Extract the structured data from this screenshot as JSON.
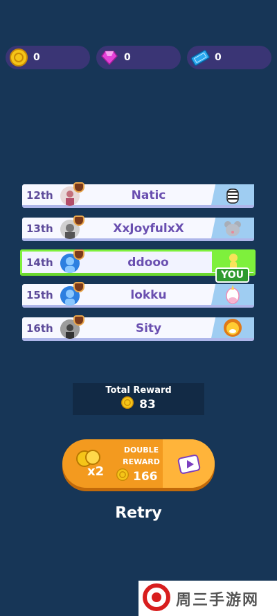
{
  "currencies": [
    {
      "name": "coin-icon",
      "value": "0",
      "color": "#f5c518"
    },
    {
      "name": "gem-icon",
      "value": "0",
      "color": "#e541d8"
    },
    {
      "name": "ticket-icon",
      "value": "0",
      "color": "#2aa8ef"
    }
  ],
  "leaderboard": [
    {
      "rank": "12th",
      "name": "Natic",
      "pet": "zebra-pet-icon"
    },
    {
      "rank": "13th",
      "name": "XxJoyfulxX",
      "pet": "mouse-pet-icon"
    },
    {
      "rank": "14th",
      "name": "ddooo",
      "pet": "player-pet-icon",
      "is_you": true
    },
    {
      "rank": "15th",
      "name": "lokku",
      "pet": "unicorn-pet-icon"
    },
    {
      "rank": "16th",
      "name": "Sity",
      "pet": "lion-pet-icon"
    }
  ],
  "you_label": "YOU",
  "total_reward": {
    "title": "Total Reward",
    "value": "83"
  },
  "double_reward": {
    "label_line1": "DOUBLE",
    "label_line2": "REWARD",
    "multiplier": "x2",
    "value": "166"
  },
  "retry_label": "Retry",
  "watermark": "周三手游网"
}
